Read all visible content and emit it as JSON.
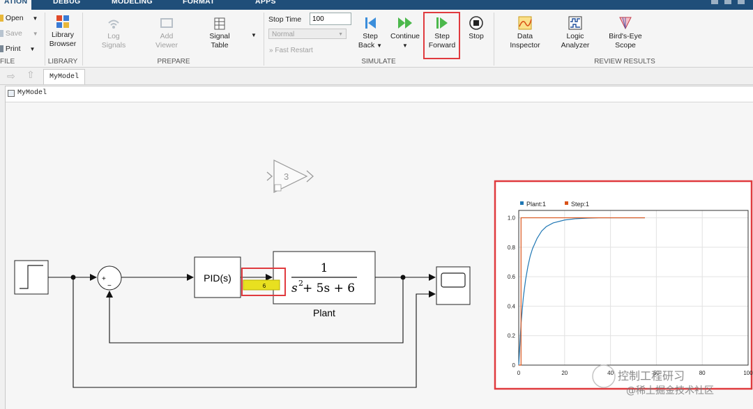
{
  "tabs": [
    "ATION",
    "DEBUG",
    "MODELING",
    "FORMAT",
    "APPS"
  ],
  "file": {
    "open": "Open",
    "save": "Save",
    "print": "Print",
    "group": "FILE"
  },
  "library": {
    "label1": "Library",
    "label2": "Browser",
    "group": "LIBRARY"
  },
  "prepare": {
    "log1": "Log",
    "log2": "Signals",
    "add1": "Add",
    "add2": "Viewer",
    "sig1": "Signal",
    "sig2": "Table",
    "group": "PREPARE"
  },
  "simulate": {
    "stop_time_label": "Stop Time",
    "stop_time_value": "100",
    "mode": "Normal",
    "fast_restart": "Fast Restart",
    "step_back1": "Step",
    "step_back2": "Back",
    "continue": "Continue",
    "step_fwd1": "Step",
    "step_fwd2": "Forward",
    "stop": "Stop",
    "group": "SIMULATE"
  },
  "review": {
    "data1": "Data",
    "data2": "Inspector",
    "logic1": "Logic",
    "logic2": "Analyzer",
    "bird1": "Bird's-Eye",
    "bird2": "Scope",
    "group": "REVIEW RESULTS"
  },
  "model_tab": "MyModel",
  "breadcrumb": "MyModel",
  "diagram": {
    "gain_value": "3",
    "pid_label": "PID(s)",
    "sum_plus": "+",
    "sum_minus": "−",
    "plant_num": "1",
    "plant_den_a": "s",
    "plant_den_exp": "2",
    "plant_den_b": " + 5s + 6",
    "plant_name": "Plant",
    "signal_value": "6"
  },
  "chart_data": {
    "type": "line",
    "series": [
      {
        "name": "Plant:1",
        "color": "#1f77b4",
        "x": [
          0,
          1,
          2,
          3,
          4,
          5,
          6,
          8,
          10,
          12,
          15,
          20,
          25,
          30,
          35,
          40,
          45,
          50,
          55
        ],
        "y": [
          0,
          0.28,
          0.46,
          0.58,
          0.67,
          0.74,
          0.79,
          0.86,
          0.91,
          0.94,
          0.965,
          0.985,
          0.994,
          0.998,
          1.0,
          1.0,
          1.0,
          1.0,
          1.0
        ]
      },
      {
        "name": "Step:1",
        "color": "#d95319",
        "x": [
          0,
          1,
          1,
          55
        ],
        "y": [
          0,
          0,
          1,
          1
        ]
      }
    ],
    "xlim": [
      0,
      100
    ],
    "ylim": [
      0,
      1.05
    ],
    "xticks": [
      "0",
      "20",
      "40",
      "60",
      "80",
      "100"
    ],
    "yticks": [
      "0",
      "0.2",
      "0.4",
      "0.6",
      "0.8",
      "1.0"
    ],
    "grid": true,
    "legend": "top-left"
  },
  "watermark1": "控制工程研习",
  "watermark2": "@稀土掘金技术社区"
}
